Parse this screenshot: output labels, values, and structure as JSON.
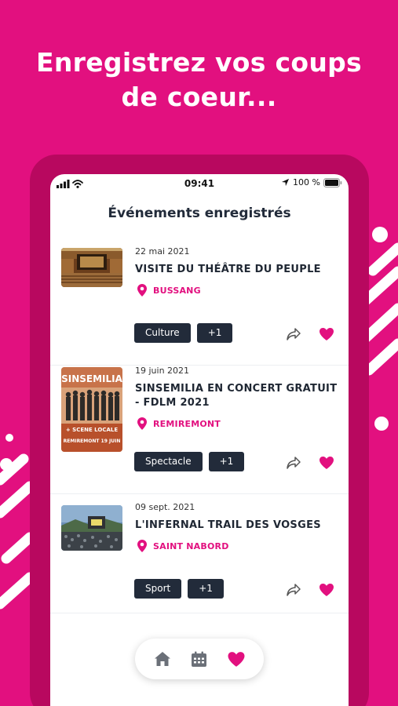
{
  "headline": {
    "line1": "Enregistrez vos coups",
    "line2": "de coeur..."
  },
  "colors": {
    "brand": "#e2107f",
    "brand_dark": "#b8085f",
    "dark": "#222b3a"
  },
  "status_bar": {
    "time": "09:41",
    "battery": "100 %"
  },
  "screen_title": "Événements enregistrés",
  "events": [
    {
      "date": "22 mai 2021",
      "title": "VISITE DU THÉÂTRE DU PEUPLE",
      "location": "BUSSANG",
      "tag": "Culture",
      "more": "+1"
    },
    {
      "date": "19 juin 2021",
      "title": "SINSEMILIA EN CONCERT GRATUIT - FDLM 2021",
      "location": "REMIREMONT",
      "tag": "Spectacle",
      "more": "+1"
    },
    {
      "date": "09 sept. 2021",
      "title": "L'INFERNAL TRAIL DES VOSGES",
      "location": "SAINT NABORD",
      "tag": "Sport",
      "more": "+1"
    }
  ],
  "icons": [
    "signal-icon",
    "wifi-icon",
    "location-arrow-icon",
    "battery-icon",
    "pin-icon",
    "share-icon",
    "heart-icon",
    "home-icon",
    "calendar-icon"
  ],
  "poster": {
    "name": "SINSEMILIA",
    "tagline": "+ SCENE LOCALE",
    "place": "REMIREMONT 19 JUIN"
  }
}
